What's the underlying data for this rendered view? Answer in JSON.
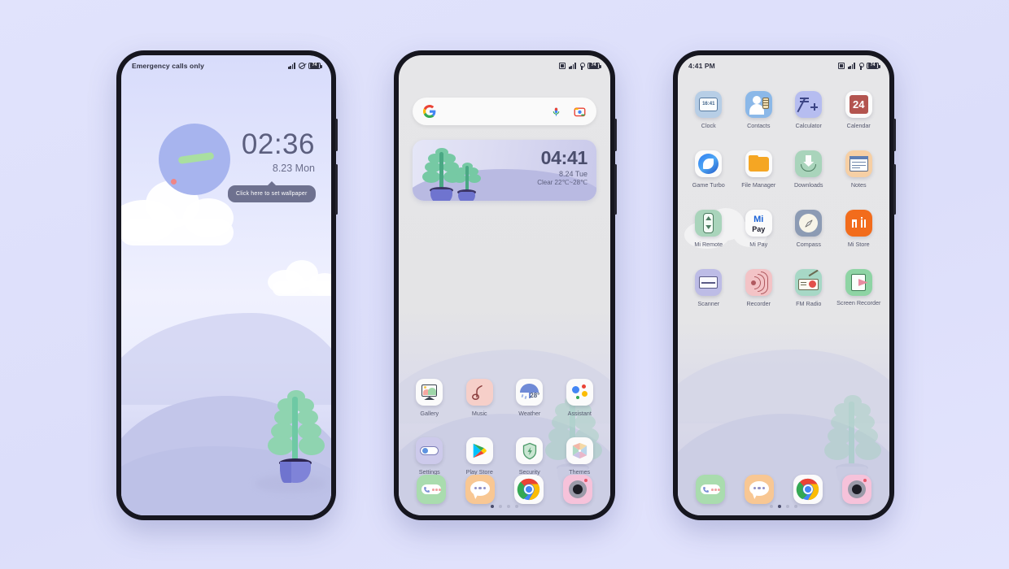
{
  "background_color": "#dfe1fb",
  "phones": {
    "lock": {
      "name": "lock-screen-phone",
      "status": {
        "left": "Emergency calls only",
        "battery": "74"
      },
      "clock": {
        "time": "02:36",
        "date": "8.23 Mon"
      },
      "tooltip": "Click here to set wallpaper"
    },
    "home": {
      "name": "home-screen-phone",
      "status": {
        "left": "",
        "battery": "74"
      },
      "search": {
        "placeholder": "",
        "google_icon": "google-g-icon",
        "mic_icon": "microphone-icon",
        "lens_icon": "google-lens-icon"
      },
      "widget": {
        "time": "04:41",
        "date": "8.24 Tue",
        "condition": "Clear 22℃~28℃"
      },
      "apps_row1": [
        {
          "label": "Gallery",
          "icon": "gallery-icon"
        },
        {
          "label": "Music",
          "icon": "music-icon"
        },
        {
          "label": "Weather",
          "icon": "weather-icon",
          "temp": "28°"
        },
        {
          "label": "Assistant",
          "icon": "google-assistant-icon"
        }
      ],
      "apps_row2": [
        {
          "label": "Settings",
          "icon": "settings-toggle-icon"
        },
        {
          "label": "Play Store",
          "icon": "play-store-icon"
        },
        {
          "label": "Security",
          "icon": "security-shield-icon"
        },
        {
          "label": "Themes",
          "icon": "themes-pinwheel-icon"
        }
      ],
      "page_dots": {
        "count": 4,
        "active": 0
      },
      "dock": [
        {
          "label": "Phone",
          "icon": "phone-dialer-icon"
        },
        {
          "label": "Messages",
          "icon": "messages-bubble-icon"
        },
        {
          "label": "Chrome",
          "icon": "chrome-icon"
        },
        {
          "label": "Camera",
          "icon": "camera-icon"
        }
      ]
    },
    "drawer": {
      "name": "app-drawer-phone",
      "status": {
        "left": "4:41 PM",
        "battery": "74"
      },
      "apps": [
        {
          "label": "Clock",
          "icon": "clock-icon",
          "face_time": "16:41"
        },
        {
          "label": "Contacts",
          "icon": "contacts-icon"
        },
        {
          "label": "Calculator",
          "icon": "calculator-icon"
        },
        {
          "label": "Calendar",
          "icon": "calendar-icon",
          "day": "24"
        },
        {
          "label": "Game Turbo",
          "icon": "game-turbo-icon"
        },
        {
          "label": "File Manager",
          "icon": "file-manager-icon"
        },
        {
          "label": "Downloads",
          "icon": "downloads-icon"
        },
        {
          "label": "Notes",
          "icon": "notes-icon"
        },
        {
          "label": "Mi Remote",
          "icon": "mi-remote-icon"
        },
        {
          "label": "Mi Pay",
          "icon": "mi-pay-icon",
          "text_top": "Mi",
          "text_bottom": "Pay"
        },
        {
          "label": "Compass",
          "icon": "compass-icon"
        },
        {
          "label": "Mi Store",
          "icon": "mi-store-icon"
        },
        {
          "label": "Scanner",
          "icon": "scanner-icon"
        },
        {
          "label": "Recorder",
          "icon": "recorder-icon"
        },
        {
          "label": "FM Radio",
          "icon": "fm-radio-icon"
        },
        {
          "label": "Screen Recorder",
          "icon": "screen-recorder-icon"
        }
      ],
      "page_dots": {
        "count": 4,
        "active": 1
      },
      "dock": [
        {
          "label": "Phone",
          "icon": "phone-dialer-icon"
        },
        {
          "label": "Messages",
          "icon": "messages-bubble-icon"
        },
        {
          "label": "Chrome",
          "icon": "chrome-icon"
        },
        {
          "label": "Camera",
          "icon": "camera-icon"
        }
      ]
    }
  },
  "colors": {
    "lock_accent": "#a7b4ee",
    "clock_hand": "#a9dfa0",
    "red_dot": "#f08585",
    "tooltip_bg": "#6e718f",
    "label_text": "#56596f"
  }
}
